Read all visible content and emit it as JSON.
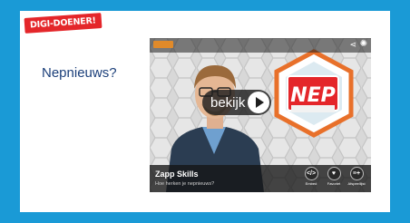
{
  "badge": {
    "text": "DIGI-DOENER!"
  },
  "slide": {
    "title": "Nepnieuws?"
  },
  "video": {
    "play_label": "bekijk",
    "sign_text": "NEP",
    "channel": "Zapp Skills",
    "subtitle": "Hoe herken je nepnieuws?",
    "controls": [
      {
        "icon": "</>",
        "label": "Embed"
      },
      {
        "icon": "♥",
        "label": "Favoriet"
      },
      {
        "icon": "≡+",
        "label": "Afspeellijst"
      }
    ]
  },
  "colors": {
    "background": "#1a9ad6",
    "badge": "#e4262a",
    "title": "#1b3f7a",
    "sign_red": "#e4262a",
    "sign_ring": "#e8702a"
  }
}
